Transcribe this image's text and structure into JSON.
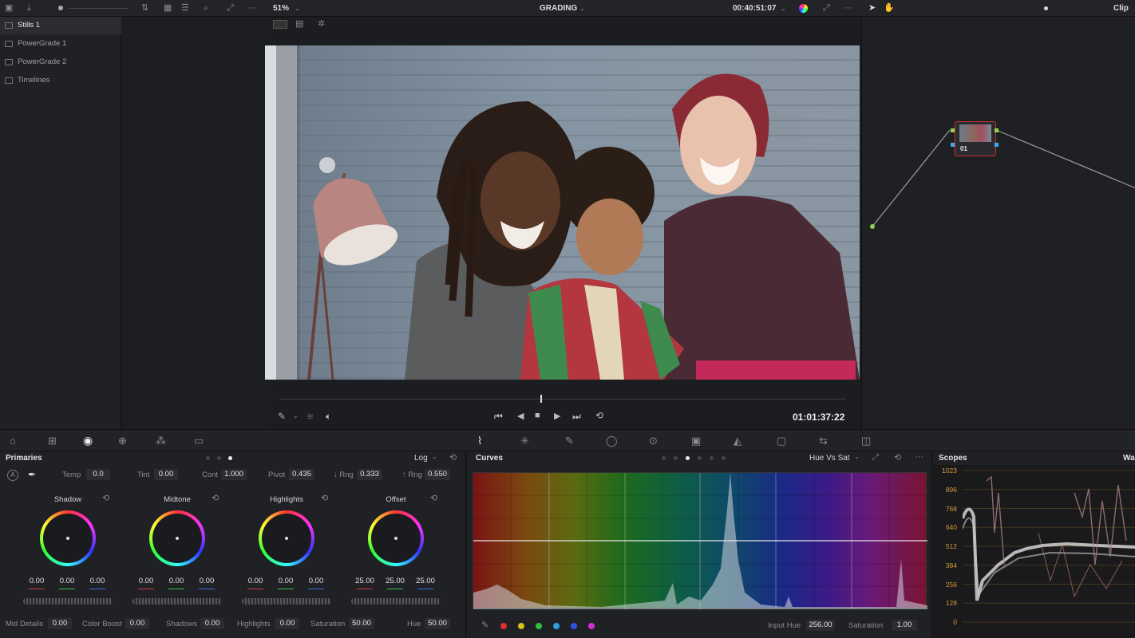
{
  "top_bar": {
    "zoom": "51%",
    "page": "GRADING",
    "timecode": "00:40:51:07",
    "right_label": "Clip"
  },
  "gallery": {
    "items": [
      {
        "label": "Stills 1",
        "selected": true
      },
      {
        "label": "PowerGrade 1",
        "selected": false
      },
      {
        "label": "PowerGrade 2",
        "selected": false
      },
      {
        "label": "Timelines",
        "selected": false
      }
    ]
  },
  "viewer": {
    "timecode": "01:01:37:22",
    "playhead_position": 0.46
  },
  "node": {
    "label": "01"
  },
  "primaries": {
    "title": "Primaries",
    "mode": "Log",
    "params_top": [
      {
        "label": "Temp",
        "value": "0.0"
      },
      {
        "label": "Tint",
        "value": "0.00"
      },
      {
        "label": "Cont",
        "value": "1.000"
      },
      {
        "label": "Pivot",
        "value": "0.435"
      },
      {
        "label": "↓ Rng",
        "value": "0.333"
      },
      {
        "label": "↑ Rng",
        "value": "0.550"
      }
    ],
    "wheels": [
      {
        "name": "Shadow",
        "values": [
          "0.00",
          "0.00",
          "0.00"
        ]
      },
      {
        "name": "Midtone",
        "values": [
          "0.00",
          "0.00",
          "0.00"
        ]
      },
      {
        "name": "Highlights",
        "values": [
          "0.00",
          "0.00",
          "0.00"
        ]
      },
      {
        "name": "Offset",
        "values": [
          "25.00",
          "25.00",
          "25.00"
        ]
      }
    ],
    "params_bottom": [
      {
        "label": "Mid Details",
        "value": "0.00"
      },
      {
        "label": "Color Boost",
        "value": "0.00"
      },
      {
        "label": "Shadows",
        "value": "0.00"
      },
      {
        "label": "Highlights",
        "value": "0.00"
      },
      {
        "label": "Saturation",
        "value": "50.00"
      },
      {
        "label": "Hue",
        "value": "50.00"
      }
    ]
  },
  "curves": {
    "title": "Curves",
    "mode": "Hue Vs Sat",
    "input_hue_label": "Input Hue",
    "input_hue_value": "256.00",
    "saturation_label": "Saturation",
    "saturation_value": "1.00",
    "swatches": [
      "#e03030",
      "#d8c020",
      "#30c040",
      "#30a0e0",
      "#3050e0",
      "#d030d0"
    ]
  },
  "scopes": {
    "title": "Scopes",
    "right_label": "Wa",
    "scale": [
      "1023",
      "896",
      "768",
      "640",
      "512",
      "384",
      "256",
      "128",
      "0"
    ]
  },
  "colors": {
    "accent": "#e63030",
    "node_border": "#c93030",
    "scale_text": "#d29a3b"
  }
}
